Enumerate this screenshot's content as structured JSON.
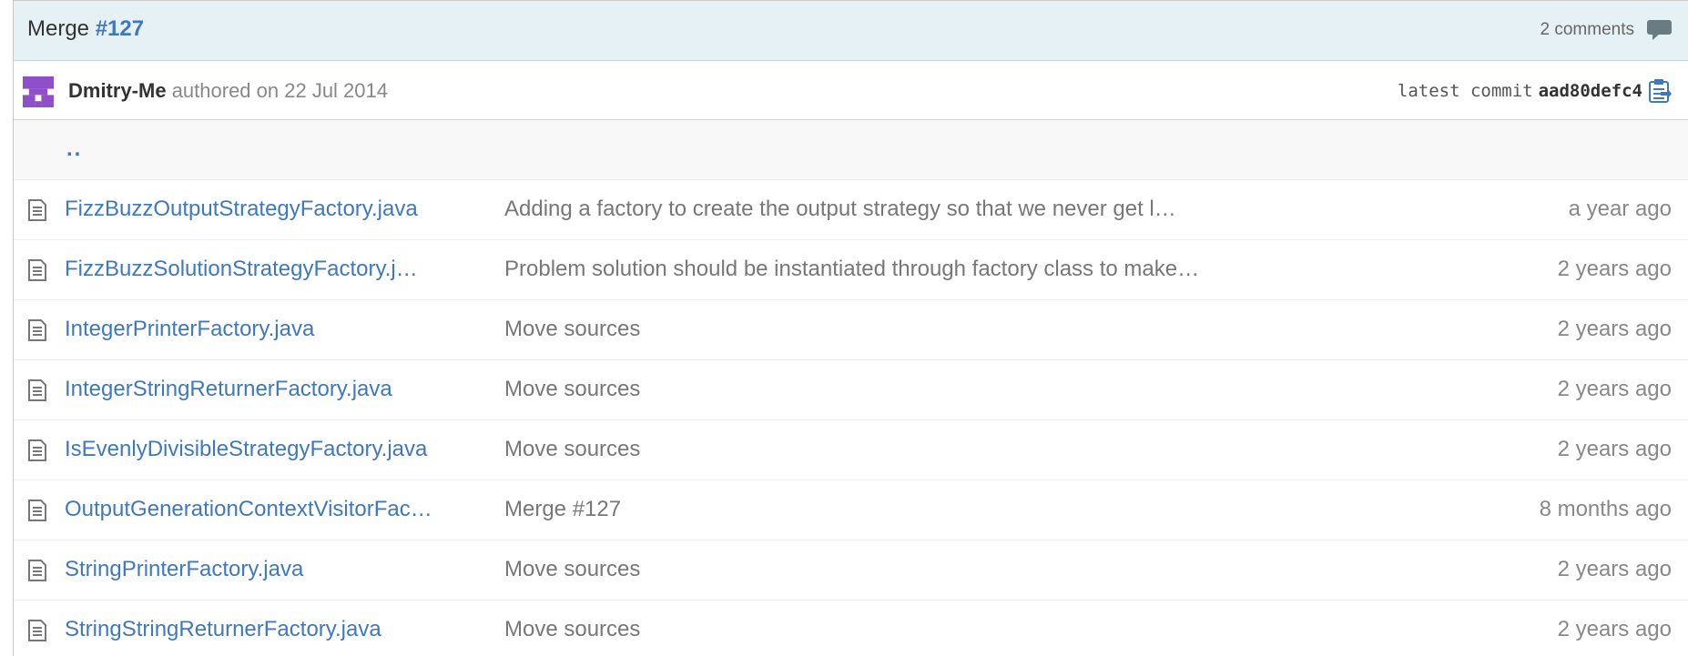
{
  "commit": {
    "title_prefix": "Merge ",
    "title_link": "#127",
    "comments": "2 comments",
    "author": "Dmitry-Me",
    "authored_text": " authored on 22 Jul 2014",
    "latest_commit_label": "latest commit ",
    "sha": "aad80defc4"
  },
  "parent_dir": "..",
  "files": [
    {
      "name": "FizzBuzzOutputStrategyFactory.java",
      "message": "Adding a factory to create the output strategy so that we never get l…",
      "age": "a year ago"
    },
    {
      "name": "FizzBuzzSolutionStrategyFactory.j…",
      "message": "Problem solution should be instantiated through factory class to make…",
      "age": "2 years ago"
    },
    {
      "name": "IntegerPrinterFactory.java",
      "message": "Move sources",
      "age": "2 years ago"
    },
    {
      "name": "IntegerStringReturnerFactory.java",
      "message": "Move sources",
      "age": "2 years ago"
    },
    {
      "name": "IsEvenlyDivisibleStrategyFactory.java",
      "message": "Move sources",
      "age": "2 years ago"
    },
    {
      "name": "OutputGenerationContextVisitorFac…",
      "message": "Merge #127",
      "age": "8 months ago"
    },
    {
      "name": "StringPrinterFactory.java",
      "message": "Move sources",
      "age": "2 years ago"
    },
    {
      "name": "StringStringReturnerFactory.java",
      "message": "Move sources",
      "age": "2 years ago"
    }
  ],
  "icons": {
    "comment": "comment-icon",
    "clipboard": "clipboard-icon",
    "file": "file-text-icon",
    "avatar": "identicon-avatar"
  },
  "colors": {
    "link": "#4078c0",
    "header_bg": "#e6f1f6",
    "avatar": "#8f4fc9"
  }
}
